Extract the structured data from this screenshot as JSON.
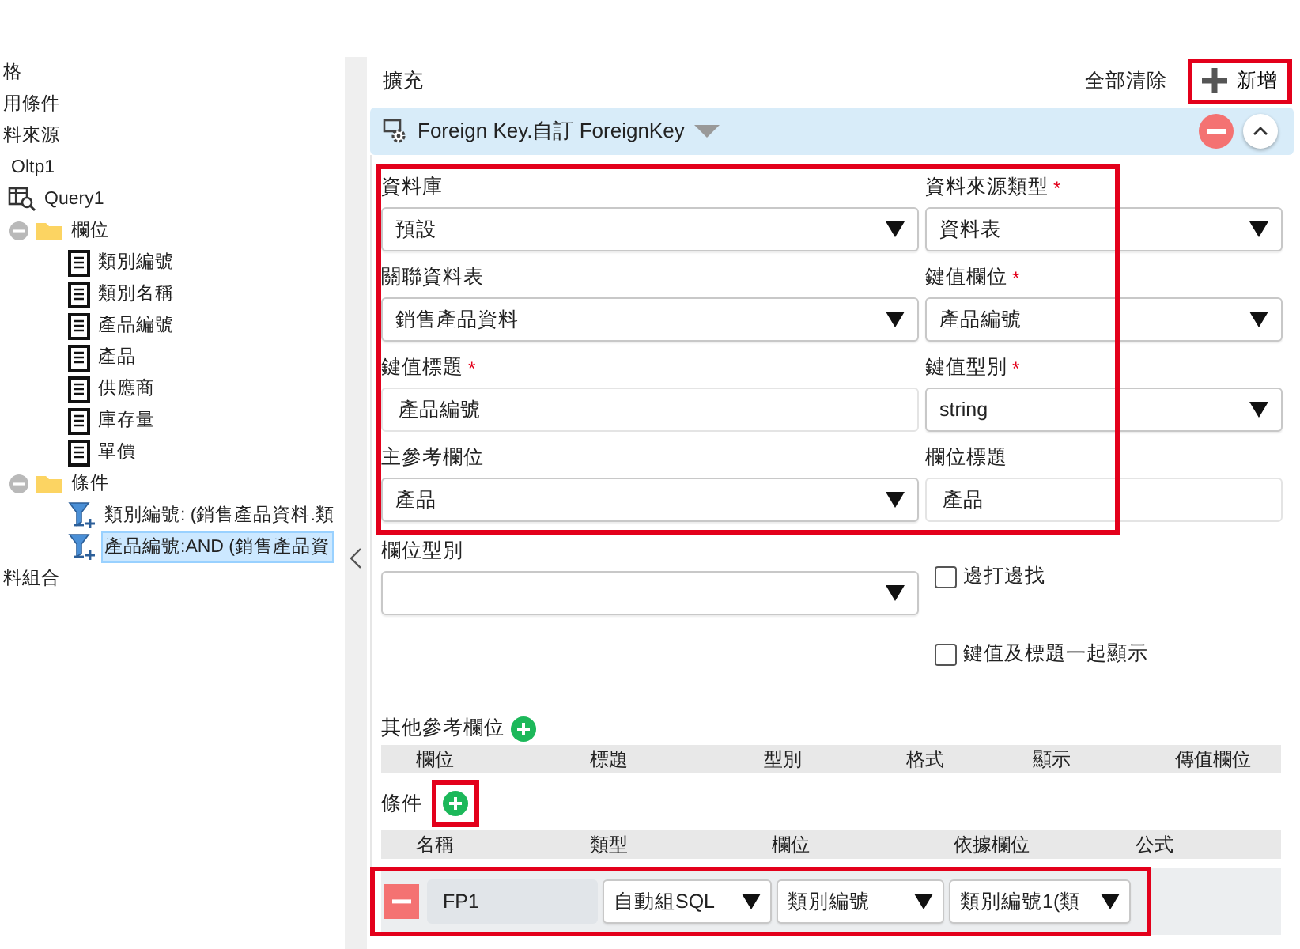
{
  "sidebar": {
    "items": [
      {
        "label": "格",
        "kind": "label",
        "selected": false
      },
      {
        "label": "用條件",
        "kind": "label",
        "selected": false
      },
      {
        "label": "料來源",
        "kind": "label",
        "selected": false,
        "children": [
          {
            "label": "Oltp1",
            "kind": "source",
            "selected": false
          },
          {
            "label": "Query1",
            "kind": "query",
            "selected": false,
            "children": [
              {
                "label": "欄位",
                "kind": "folder",
                "expanded": true,
                "selected": false,
                "children": [
                  {
                    "label": "類別編號",
                    "kind": "field",
                    "selected": false
                  },
                  {
                    "label": "類別名稱",
                    "kind": "field",
                    "selected": false
                  },
                  {
                    "label": "產品編號",
                    "kind": "field",
                    "selected": false
                  },
                  {
                    "label": "產品",
                    "kind": "field",
                    "selected": false
                  },
                  {
                    "label": "供應商",
                    "kind": "field",
                    "selected": false
                  },
                  {
                    "label": "庫存量",
                    "kind": "field",
                    "selected": false
                  },
                  {
                    "label": "單價",
                    "kind": "field",
                    "selected": false
                  }
                ]
              },
              {
                "label": "條件",
                "kind": "folder",
                "expanded": true,
                "selected": false,
                "children": [
                  {
                    "label": "類別編號: (銷售產品資料.類",
                    "kind": "filter",
                    "selected": false
                  },
                  {
                    "label": "產品編號:AND (銷售產品資",
                    "kind": "filter",
                    "selected": true
                  }
                ]
              }
            ]
          }
        ]
      },
      {
        "label": "料組合",
        "kind": "label",
        "selected": false
      }
    ]
  },
  "toolbar": {
    "title": "擴充",
    "clear_all": "全部清除",
    "add": {
      "label": "新增",
      "highlighted": true
    }
  },
  "panel": {
    "title": "Foreign Key.自訂 ForeignKey",
    "expanded": true
  },
  "form": {
    "highlighted": true,
    "fields": [
      {
        "label": "資料庫",
        "kind": "select",
        "value": "預設"
      },
      {
        "label": "資料來源類型",
        "required_mark": "*",
        "kind": "select",
        "value": "資料表"
      },
      {
        "label": "關聯資料表",
        "kind": "select",
        "value": "銷售產品資料"
      },
      {
        "label": "鍵值欄位",
        "required_mark": "*",
        "kind": "select",
        "value": "產品編號"
      },
      {
        "label": "鍵值標題",
        "required_mark": "*",
        "kind": "text",
        "value": "產品編號"
      },
      {
        "label": "鍵值型別",
        "required_mark": "*",
        "kind": "select",
        "value": "string"
      },
      {
        "label": "主參考欄位",
        "kind": "select",
        "value": "產品"
      },
      {
        "label": "欄位標題",
        "kind": "text",
        "value": "產品"
      }
    ]
  },
  "field_type": {
    "label": "欄位型別",
    "kind": "select"
  },
  "options": [
    {
      "label": "邊打邊找",
      "checked": false
    },
    {
      "label": "鍵值及標題一起顯示",
      "checked": false
    }
  ],
  "other_fields": {
    "title": "其他參考欄位",
    "columns": [
      "欄位",
      "標題",
      "型別",
      "格式",
      "顯示",
      "傳值欄位"
    ]
  },
  "conditions": {
    "title": "條件",
    "add_highlighted": true,
    "columns": [
      "名稱",
      "類型",
      "欄位",
      "依據欄位",
      "公式"
    ],
    "rows": [
      {
        "highlighted": true,
        "name": "FP1",
        "type": "自動組SQL",
        "field": "類別編號",
        "source_field": "類別編號1(類"
      }
    ]
  }
}
